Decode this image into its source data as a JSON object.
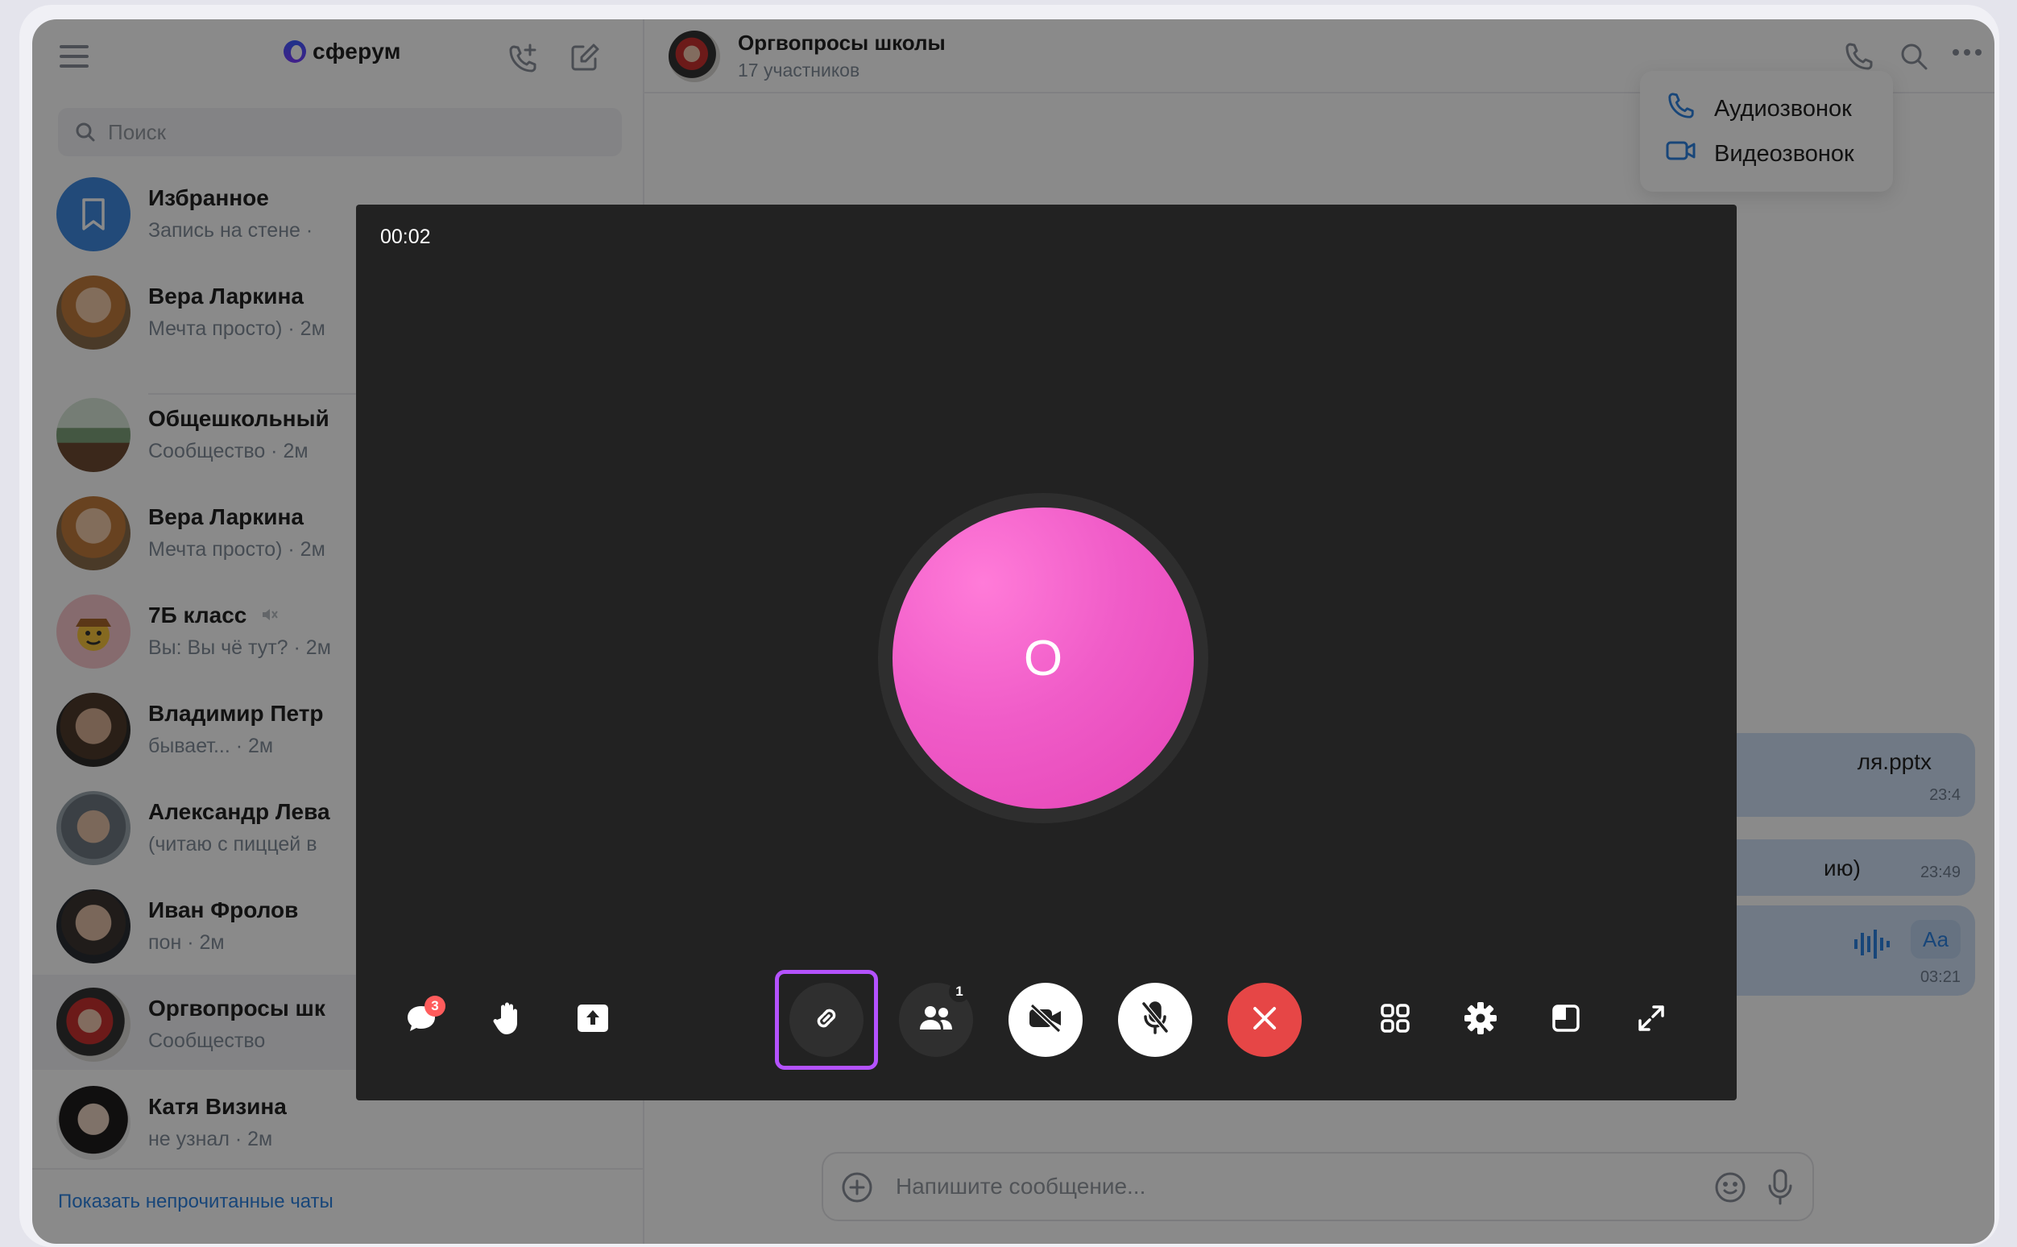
{
  "sidebar": {
    "logo": "сферум",
    "search_placeholder": "Поиск",
    "chats": [
      {
        "name": "Избранное",
        "sub": "Запись на стене ·"
      },
      {
        "name": "Вера Ларкина",
        "sub": "Мечта просто) · 2м"
      },
      {
        "name": "Общешкольный",
        "sub": "Сообщество · 2м"
      },
      {
        "name": "Вера Ларкина",
        "sub": "Мечта просто) · 2м"
      },
      {
        "name": "7Б класс",
        "sub": "Вы: Вы чё тут? · 2м"
      },
      {
        "name": "Владимир Петр",
        "sub": "бывает... · 2м"
      },
      {
        "name": "Александр Лева",
        "sub": "(читаю с пиццей в"
      },
      {
        "name": "Иван Фролов",
        "sub": "пон · 2м"
      },
      {
        "name": "Оргвопросы шк",
        "sub": "Сообщество"
      },
      {
        "name": "Катя Визина",
        "sub": "не узнал · 2м"
      }
    ],
    "show_unread": "Показать непрочитанные чаты"
  },
  "conversation": {
    "title": "Оргвопросы школы",
    "subtitle": "17 участников",
    "dropdown": {
      "audio": "Аудиозвонок",
      "video": "Видеозвонок"
    },
    "messages": {
      "file_name": "ля.pptx",
      "file_time": "23:4",
      "text_tail": "ию)",
      "text_time": "23:49",
      "voice_label": "Аа",
      "voice_time": "03:21"
    },
    "composer_placeholder": "Напишите сообщение..."
  },
  "call": {
    "timer": "00:02",
    "avatar_letter": "О",
    "chat_badge": "3",
    "participants_badge": "1"
  },
  "colors": {
    "accent_highlight": "#b452ff",
    "end_call": "#e64646",
    "avatar_pink": "#f05cc8",
    "link_blue": "#2d81e0"
  },
  "icons": [
    "menu-icon",
    "phone-plus-icon",
    "compose-icon",
    "search-icon",
    "phone-icon",
    "more-icon",
    "video-icon",
    "chat-icon",
    "raise-hand-icon",
    "share-screen-icon",
    "link-icon",
    "participants-icon",
    "camera-off-icon",
    "mic-off-icon",
    "close-icon",
    "grid-icon",
    "gear-icon",
    "pip-icon",
    "fullscreen-icon",
    "add-icon",
    "emoji-icon",
    "mic-icon"
  ]
}
